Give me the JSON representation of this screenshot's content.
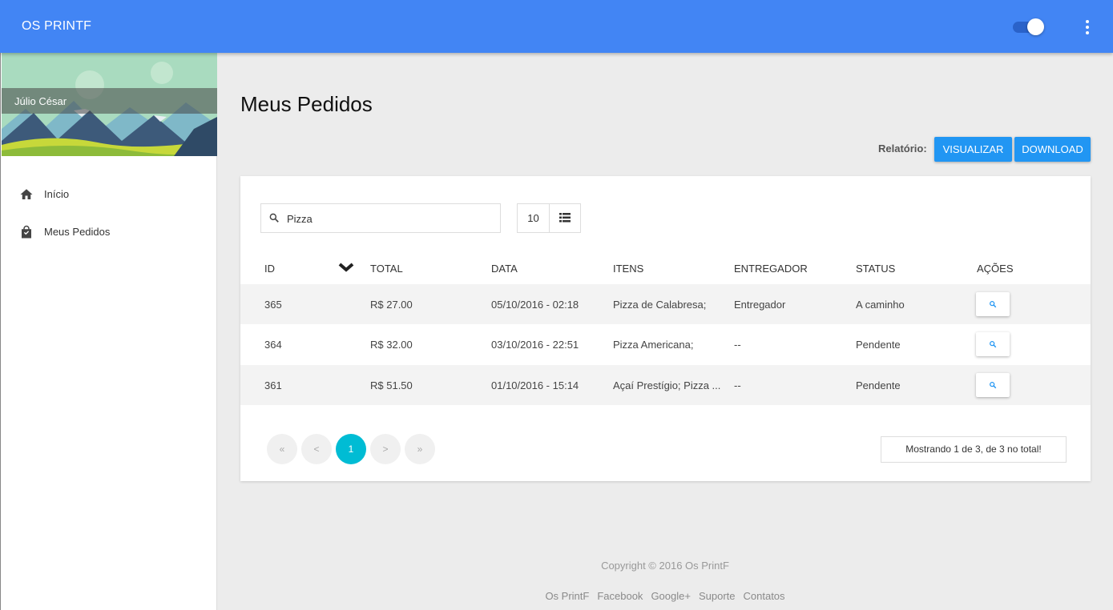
{
  "app": {
    "title": "OS PRINTF"
  },
  "toolbar": {
    "theme_toggle": "on",
    "menu_icon": "more-vert-icon"
  },
  "sidebar": {
    "user_name": "Júlio César",
    "items": [
      {
        "label": "Início",
        "icon": "home-icon"
      },
      {
        "label": "Meus Pedidos",
        "icon": "shopping-bag-icon"
      }
    ]
  },
  "main": {
    "title": "Meus Pedidos",
    "report": {
      "label": "Relatório:",
      "view_button": "VISUALIZAR",
      "download_button": "DOWNLOAD"
    },
    "table": {
      "search_value": "Pizza",
      "page_size": "10",
      "headers": {
        "id": "ID",
        "total": "TOTAL",
        "date": "DATA",
        "items": "ITENS",
        "courier": "ENTREGADOR",
        "status": "STATUS",
        "actions": "AÇÕES"
      },
      "rows": [
        {
          "id": "365",
          "total": "R$ 27.00",
          "date": "05/10/2016 - 02:18",
          "items": "Pizza de Calabresa;",
          "courier": "Entregador",
          "status": "A caminho"
        },
        {
          "id": "364",
          "total": "R$ 32.00",
          "date": "03/10/2016 - 22:51",
          "items": "Pizza Americana;",
          "courier": "--",
          "status": "Pendente"
        },
        {
          "id": "361",
          "total": "R$ 51.50",
          "date": "01/10/2016 - 15:14",
          "items": "Açaí Prestígio; Pizza ...",
          "courier": "--",
          "status": "Pendente"
        }
      ],
      "pagination": {
        "first": "«",
        "prev": "<",
        "current": "1",
        "next": ">",
        "last": "»"
      },
      "showing": "Mostrando 1 de 3, de 3 no total!"
    }
  },
  "footer": {
    "copyright": "Copyright © 2016 Os PrintF",
    "links": [
      "Os PrintF",
      "Facebook",
      "Google+",
      "Suporte",
      "Contatos"
    ]
  },
  "colors": {
    "primary": "#4285f4",
    "accent": "#2196f3",
    "page_active": "#00bcd4"
  }
}
